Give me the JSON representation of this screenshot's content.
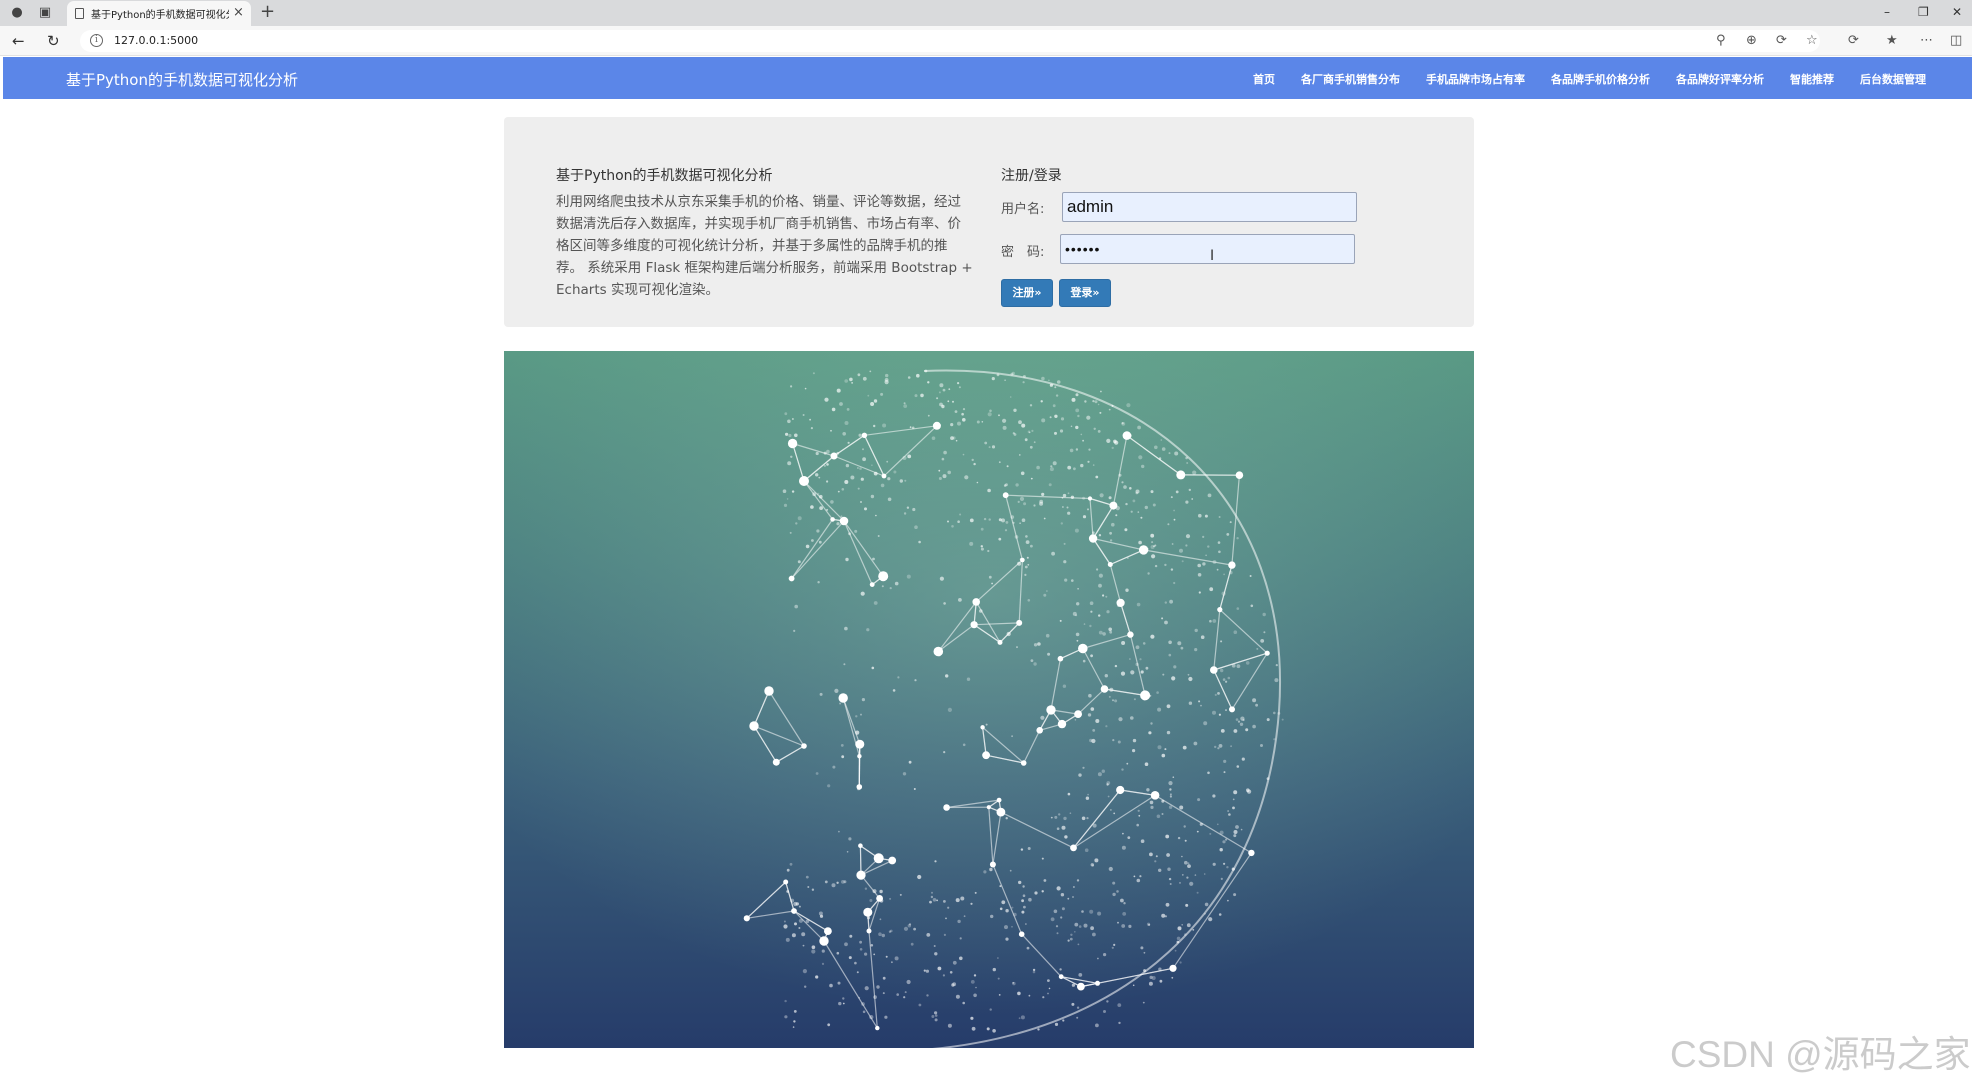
{
  "browser": {
    "tab_title": "基于Python的手机数据可视化分析",
    "url": "127.0.0.1:5000"
  },
  "navbar": {
    "brand": "基于Python的手机数据可视化分析",
    "links": [
      "首页",
      "各厂商手机销售分布",
      "手机品牌市场占有率",
      "各品牌手机价格分析",
      "各品牌好评率分析",
      "智能推荐",
      "后台数据管理"
    ]
  },
  "intro": {
    "title": "基于Python的手机数据可视化分析",
    "text": "利用网络爬虫技术从京东采集手机的价格、销量、评论等数据，经过数据清洗后存入数据库，并实现手机厂商手机销售、市场占有率、价格区间等多维度的可视化统计分析，并基于多属性的品牌手机的推荐。 系统采用 Flask 框架构建后端分析服务，前端采用 Bootstrap + Echarts 实现可视化渲染。"
  },
  "login": {
    "title": "注册/登录",
    "username_label": "用户名:",
    "username_value": "admin",
    "password_label": "密　码:",
    "password_value": "••••••",
    "register_label": "注册»",
    "login_label": "登录»"
  },
  "watermark": "CSDN @源码之家"
}
